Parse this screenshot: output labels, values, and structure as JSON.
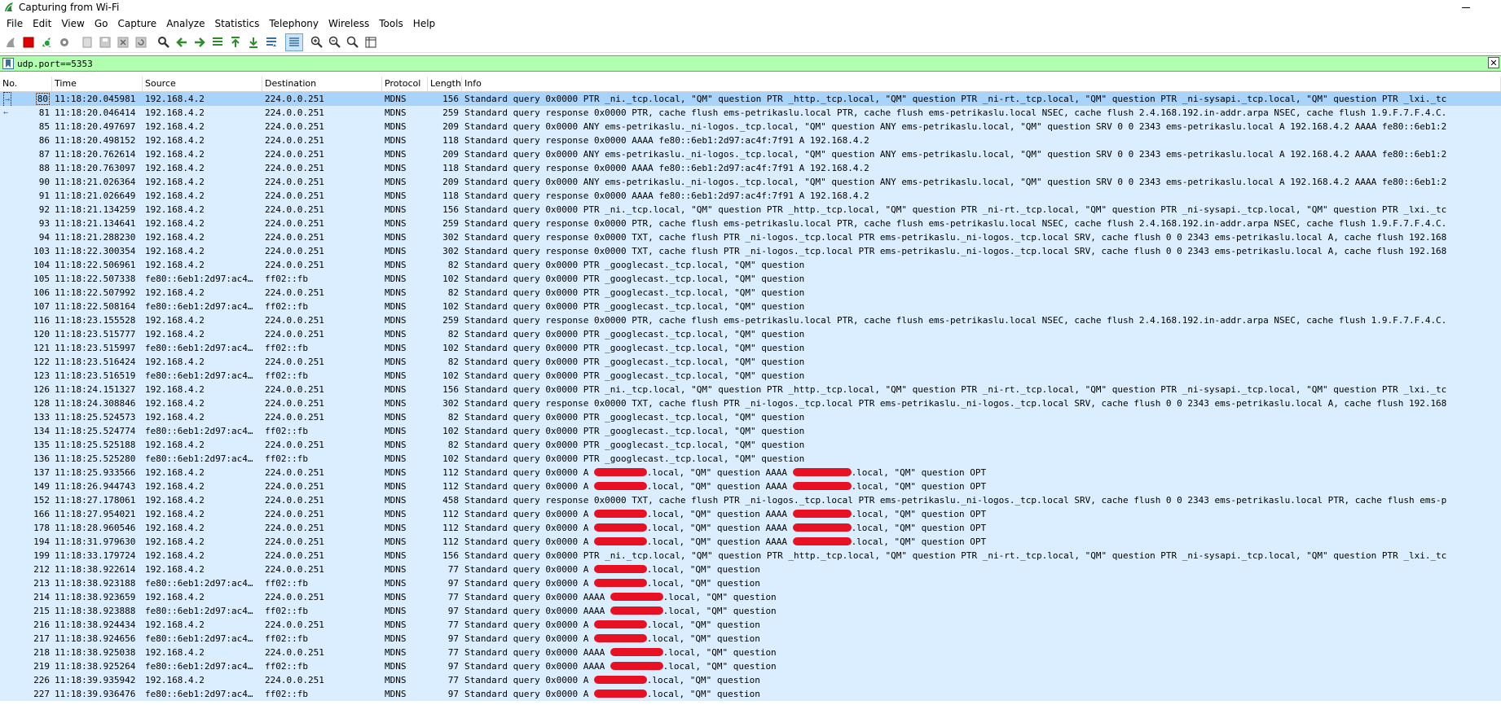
{
  "window": {
    "title": "Capturing from Wi-Fi"
  },
  "menu": [
    "File",
    "Edit",
    "View",
    "Go",
    "Capture",
    "Analyze",
    "Statistics",
    "Telephony",
    "Wireless",
    "Tools",
    "Help"
  ],
  "toolbar": {
    "icons": [
      "shark-fin-icon",
      "stop-icon",
      "restart-icon",
      "options-gear-icon",
      "open-file-icon",
      "save-file-icon",
      "close-file-icon",
      "reload-file-icon",
      "find-icon",
      "back-icon",
      "forward-icon",
      "goto-packet-icon",
      "first-packet-icon",
      "last-packet-icon",
      "autoscroll-icon",
      "colorize-icon",
      "zoom-in-icon",
      "zoom-out-icon",
      "zoom-normal-icon",
      "resize-columns-icon"
    ]
  },
  "filter": {
    "value": "udp.port==5353",
    "bg_color": "#afffaf"
  },
  "columns": [
    "No.",
    "Time",
    "Source",
    "Destination",
    "Protocol",
    "Length",
    "Info"
  ],
  "colors": {
    "row_bg": "#daeeff",
    "selected_bg": "#a8d4fb",
    "redaction": "#e81123"
  },
  "packets": [
    {
      "no": "80",
      "time": "11:18:20.045981",
      "src": "192.168.4.2",
      "dst": "224.0.0.251",
      "proto": "MDNS",
      "len": "156",
      "info": [
        {
          "t": "Standard query 0x0000 PTR _ni._tcp.local, \"QM\" question PTR _http._tcp.local, \"QM\" question PTR _ni-rt._tcp.local, \"QM\" question PTR _ni-sysapi._tcp.local, \"QM\" question PTR _lxi._tc"
        }
      ]
    },
    {
      "no": "81",
      "time": "11:18:20.046414",
      "src": "192.168.4.2",
      "dst": "224.0.0.251",
      "proto": "MDNS",
      "len": "259",
      "info": [
        {
          "t": "Standard query response 0x0000 PTR, cache flush ems-petrikaslu.local PTR, cache flush ems-petrikaslu.local NSEC, cache flush 2.4.168.192.in-addr.arpa NSEC, cache flush 1.9.F.7.F.4.C."
        }
      ]
    },
    {
      "no": "85",
      "time": "11:18:20.497697",
      "src": "192.168.4.2",
      "dst": "224.0.0.251",
      "proto": "MDNS",
      "len": "209",
      "info": [
        {
          "t": "Standard query 0x0000 ANY ems-petrikaslu._ni-logos._tcp.local, \"QM\" question ANY ems-petrikaslu.local, \"QM\" question SRV 0 0 2343 ems-petrikaslu.local A 192.168.4.2 AAAA fe80::6eb1:2"
        }
      ]
    },
    {
      "no": "86",
      "time": "11:18:20.498152",
      "src": "192.168.4.2",
      "dst": "224.0.0.251",
      "proto": "MDNS",
      "len": "118",
      "info": [
        {
          "t": "Standard query response 0x0000 AAAA fe80::6eb1:2d97:ac4f:7f91 A 192.168.4.2"
        }
      ]
    },
    {
      "no": "87",
      "time": "11:18:20.762614",
      "src": "192.168.4.2",
      "dst": "224.0.0.251",
      "proto": "MDNS",
      "len": "209",
      "info": [
        {
          "t": "Standard query 0x0000 ANY ems-petrikaslu._ni-logos._tcp.local, \"QM\" question ANY ems-petrikaslu.local, \"QM\" question SRV 0 0 2343 ems-petrikaslu.local A 192.168.4.2 AAAA fe80::6eb1:2"
        }
      ]
    },
    {
      "no": "88",
      "time": "11:18:20.763097",
      "src": "192.168.4.2",
      "dst": "224.0.0.251",
      "proto": "MDNS",
      "len": "118",
      "info": [
        {
          "t": "Standard query response 0x0000 AAAA fe80::6eb1:2d97:ac4f:7f91 A 192.168.4.2"
        }
      ]
    },
    {
      "no": "90",
      "time": "11:18:21.026364",
      "src": "192.168.4.2",
      "dst": "224.0.0.251",
      "proto": "MDNS",
      "len": "209",
      "info": [
        {
          "t": "Standard query 0x0000 ANY ems-petrikaslu._ni-logos._tcp.local, \"QM\" question ANY ems-petrikaslu.local, \"QM\" question SRV 0 0 2343 ems-petrikaslu.local A 192.168.4.2 AAAA fe80::6eb1:2"
        }
      ]
    },
    {
      "no": "91",
      "time": "11:18:21.026649",
      "src": "192.168.4.2",
      "dst": "224.0.0.251",
      "proto": "MDNS",
      "len": "118",
      "info": [
        {
          "t": "Standard query response 0x0000 AAAA fe80::6eb1:2d97:ac4f:7f91 A 192.168.4.2"
        }
      ]
    },
    {
      "no": "92",
      "time": "11:18:21.134259",
      "src": "192.168.4.2",
      "dst": "224.0.0.251",
      "proto": "MDNS",
      "len": "156",
      "info": [
        {
          "t": "Standard query 0x0000 PTR _ni._tcp.local, \"QM\" question PTR _http._tcp.local, \"QM\" question PTR _ni-rt._tcp.local, \"QM\" question PTR _ni-sysapi._tcp.local, \"QM\" question PTR _lxi._tc"
        }
      ]
    },
    {
      "no": "93",
      "time": "11:18:21.134641",
      "src": "192.168.4.2",
      "dst": "224.0.0.251",
      "proto": "MDNS",
      "len": "259",
      "info": [
        {
          "t": "Standard query response 0x0000 PTR, cache flush ems-petrikaslu.local PTR, cache flush ems-petrikaslu.local NSEC, cache flush 2.4.168.192.in-addr.arpa NSEC, cache flush 1.9.F.7.F.4.C."
        }
      ]
    },
    {
      "no": "94",
      "time": "11:18:21.288230",
      "src": "192.168.4.2",
      "dst": "224.0.0.251",
      "proto": "MDNS",
      "len": "302",
      "info": [
        {
          "t": "Standard query response 0x0000 TXT, cache flush PTR _ni-logos._tcp.local PTR ems-petrikaslu._ni-logos._tcp.local SRV, cache flush 0 0 2343 ems-petrikaslu.local A, cache flush 192.168"
        }
      ]
    },
    {
      "no": "103",
      "time": "11:18:22.300354",
      "src": "192.168.4.2",
      "dst": "224.0.0.251",
      "proto": "MDNS",
      "len": "302",
      "info": [
        {
          "t": "Standard query response 0x0000 TXT, cache flush PTR _ni-logos._tcp.local PTR ems-petrikaslu._ni-logos._tcp.local SRV, cache flush 0 0 2343 ems-petrikaslu.local A, cache flush 192.168"
        }
      ]
    },
    {
      "no": "104",
      "time": "11:18:22.506961",
      "src": "192.168.4.2",
      "dst": "224.0.0.251",
      "proto": "MDNS",
      "len": "82",
      "info": [
        {
          "t": "Standard query 0x0000 PTR _googlecast._tcp.local, \"QM\" question"
        }
      ]
    },
    {
      "no": "105",
      "time": "11:18:22.507338",
      "src": "fe80::6eb1:2d97:ac4…",
      "dst": "ff02::fb",
      "proto": "MDNS",
      "len": "102",
      "info": [
        {
          "t": "Standard query 0x0000 PTR _googlecast._tcp.local, \"QM\" question"
        }
      ]
    },
    {
      "no": "106",
      "time": "11:18:22.507992",
      "src": "192.168.4.2",
      "dst": "224.0.0.251",
      "proto": "MDNS",
      "len": "82",
      "info": [
        {
          "t": "Standard query 0x0000 PTR _googlecast._tcp.local, \"QM\" question"
        }
      ]
    },
    {
      "no": "107",
      "time": "11:18:22.508164",
      "src": "fe80::6eb1:2d97:ac4…",
      "dst": "ff02::fb",
      "proto": "MDNS",
      "len": "102",
      "info": [
        {
          "t": "Standard query 0x0000 PTR _googlecast._tcp.local, \"QM\" question"
        }
      ]
    },
    {
      "no": "116",
      "time": "11:18:23.155528",
      "src": "192.168.4.2",
      "dst": "224.0.0.251",
      "proto": "MDNS",
      "len": "259",
      "info": [
        {
          "t": "Standard query response 0x0000 PTR, cache flush ems-petrikaslu.local PTR, cache flush ems-petrikaslu.local NSEC, cache flush 2.4.168.192.in-addr.arpa NSEC, cache flush 1.9.F.7.F.4.C."
        }
      ]
    },
    {
      "no": "120",
      "time": "11:18:23.515777",
      "src": "192.168.4.2",
      "dst": "224.0.0.251",
      "proto": "MDNS",
      "len": "82",
      "info": [
        {
          "t": "Standard query 0x0000 PTR _googlecast._tcp.local, \"QM\" question"
        }
      ]
    },
    {
      "no": "121",
      "time": "11:18:23.515997",
      "src": "fe80::6eb1:2d97:ac4…",
      "dst": "ff02::fb",
      "proto": "MDNS",
      "len": "102",
      "info": [
        {
          "t": "Standard query 0x0000 PTR _googlecast._tcp.local, \"QM\" question"
        }
      ]
    },
    {
      "no": "122",
      "time": "11:18:23.516424",
      "src": "192.168.4.2",
      "dst": "224.0.0.251",
      "proto": "MDNS",
      "len": "82",
      "info": [
        {
          "t": "Standard query 0x0000 PTR _googlecast._tcp.local, \"QM\" question"
        }
      ]
    },
    {
      "no": "123",
      "time": "11:18:23.516519",
      "src": "fe80::6eb1:2d97:ac4…",
      "dst": "ff02::fb",
      "proto": "MDNS",
      "len": "102",
      "info": [
        {
          "t": "Standard query 0x0000 PTR _googlecast._tcp.local, \"QM\" question"
        }
      ]
    },
    {
      "no": "126",
      "time": "11:18:24.151327",
      "src": "192.168.4.2",
      "dst": "224.0.0.251",
      "proto": "MDNS",
      "len": "156",
      "info": [
        {
          "t": "Standard query 0x0000 PTR _ni._tcp.local, \"QM\" question PTR _http._tcp.local, \"QM\" question PTR _ni-rt._tcp.local, \"QM\" question PTR _ni-sysapi._tcp.local, \"QM\" question PTR _lxi._tc"
        }
      ]
    },
    {
      "no": "128",
      "time": "11:18:24.308846",
      "src": "192.168.4.2",
      "dst": "224.0.0.251",
      "proto": "MDNS",
      "len": "302",
      "info": [
        {
          "t": "Standard query response 0x0000 TXT, cache flush PTR _ni-logos._tcp.local PTR ems-petrikaslu._ni-logos._tcp.local SRV, cache flush 0 0 2343 ems-petrikaslu.local A, cache flush 192.168"
        }
      ]
    },
    {
      "no": "133",
      "time": "11:18:25.524573",
      "src": "192.168.4.2",
      "dst": "224.0.0.251",
      "proto": "MDNS",
      "len": "82",
      "info": [
        {
          "t": "Standard query 0x0000 PTR _googlecast._tcp.local, \"QM\" question"
        }
      ]
    },
    {
      "no": "134",
      "time": "11:18:25.524774",
      "src": "fe80::6eb1:2d97:ac4…",
      "dst": "ff02::fb",
      "proto": "MDNS",
      "len": "102",
      "info": [
        {
          "t": "Standard query 0x0000 PTR _googlecast._tcp.local, \"QM\" question"
        }
      ]
    },
    {
      "no": "135",
      "time": "11:18:25.525188",
      "src": "192.168.4.2",
      "dst": "224.0.0.251",
      "proto": "MDNS",
      "len": "82",
      "info": [
        {
          "t": "Standard query 0x0000 PTR _googlecast._tcp.local, \"QM\" question"
        }
      ]
    },
    {
      "no": "136",
      "time": "11:18:25.525280",
      "src": "fe80::6eb1:2d97:ac4…",
      "dst": "ff02::fb",
      "proto": "MDNS",
      "len": "102",
      "info": [
        {
          "t": "Standard query 0x0000 PTR _googlecast._tcp.local, \"QM\" question"
        }
      ]
    },
    {
      "no": "137",
      "time": "11:18:25.933566",
      "src": "192.168.4.2",
      "dst": "224.0.0.251",
      "proto": "MDNS",
      "len": "112",
      "info": [
        {
          "t": "Standard query 0x0000 A "
        },
        {
          "r": 9
        },
        {
          "t": ".local, \"QM\" question AAAA "
        },
        {
          "r": 10
        },
        {
          "t": ".local, \"QM\" question OPT"
        }
      ]
    },
    {
      "no": "149",
      "time": "11:18:26.944743",
      "src": "192.168.4.2",
      "dst": "224.0.0.251",
      "proto": "MDNS",
      "len": "112",
      "info": [
        {
          "t": "Standard query 0x0000 A "
        },
        {
          "r": 9
        },
        {
          "t": ".local, \"QM\" question AAAA "
        },
        {
          "r": 10
        },
        {
          "t": ".local, \"QM\" question OPT"
        }
      ]
    },
    {
      "no": "152",
      "time": "11:18:27.178061",
      "src": "192.168.4.2",
      "dst": "224.0.0.251",
      "proto": "MDNS",
      "len": "458",
      "info": [
        {
          "t": "Standard query response 0x0000 TXT, cache flush PTR _ni-logos._tcp.local PTR ems-petrikaslu._ni-logos._tcp.local SRV, cache flush 0 0 2343 ems-petrikaslu.local PTR, cache flush ems-p"
        }
      ]
    },
    {
      "no": "166",
      "time": "11:18:27.954021",
      "src": "192.168.4.2",
      "dst": "224.0.0.251",
      "proto": "MDNS",
      "len": "112",
      "info": [
        {
          "t": "Standard query 0x0000 A "
        },
        {
          "r": 9
        },
        {
          "t": ".local, \"QM\" question AAAA "
        },
        {
          "r": 10
        },
        {
          "t": ".local, \"QM\" question OPT"
        }
      ]
    },
    {
      "no": "178",
      "time": "11:18:28.960546",
      "src": "192.168.4.2",
      "dst": "224.0.0.251",
      "proto": "MDNS",
      "len": "112",
      "info": [
        {
          "t": "Standard query 0x0000 A "
        },
        {
          "r": 9
        },
        {
          "t": ".local, \"QM\" question AAAA "
        },
        {
          "r": 10
        },
        {
          "t": ".local, \"QM\" question OPT"
        }
      ]
    },
    {
      "no": "194",
      "time": "11:18:31.979630",
      "src": "192.168.4.2",
      "dst": "224.0.0.251",
      "proto": "MDNS",
      "len": "112",
      "info": [
        {
          "t": "Standard query 0x0000 A "
        },
        {
          "r": 9
        },
        {
          "t": ".local, \"QM\" question AAAA "
        },
        {
          "r": 10
        },
        {
          "t": ".local, \"QM\" question OPT"
        }
      ]
    },
    {
      "no": "199",
      "time": "11:18:33.179724",
      "src": "192.168.4.2",
      "dst": "224.0.0.251",
      "proto": "MDNS",
      "len": "156",
      "info": [
        {
          "t": "Standard query 0x0000 PTR _ni._tcp.local, \"QM\" question PTR _http._tcp.local, \"QM\" question PTR _ni-rt._tcp.local, \"QM\" question PTR _ni-sysapi._tcp.local, \"QM\" question PTR _lxi._tc"
        }
      ]
    },
    {
      "no": "212",
      "time": "11:18:38.922614",
      "src": "192.168.4.2",
      "dst": "224.0.0.251",
      "proto": "MDNS",
      "len": "77",
      "info": [
        {
          "t": "Standard query 0x0000 A "
        },
        {
          "r": 9
        },
        {
          "t": ".local, \"QM\" question"
        }
      ]
    },
    {
      "no": "213",
      "time": "11:18:38.923188",
      "src": "fe80::6eb1:2d97:ac4…",
      "dst": "ff02::fb",
      "proto": "MDNS",
      "len": "97",
      "info": [
        {
          "t": "Standard query 0x0000 A "
        },
        {
          "r": 9
        },
        {
          "t": ".local, \"QM\" question"
        }
      ]
    },
    {
      "no": "214",
      "time": "11:18:38.923659",
      "src": "192.168.4.2",
      "dst": "224.0.0.251",
      "proto": "MDNS",
      "len": "77",
      "info": [
        {
          "t": "Standard query 0x0000 AAAA "
        },
        {
          "r": 9
        },
        {
          "t": ".local, \"QM\" question"
        }
      ]
    },
    {
      "no": "215",
      "time": "11:18:38.923888",
      "src": "fe80::6eb1:2d97:ac4…",
      "dst": "ff02::fb",
      "proto": "MDNS",
      "len": "97",
      "info": [
        {
          "t": "Standard query 0x0000 AAAA "
        },
        {
          "r": 9
        },
        {
          "t": ".local, \"QM\" question"
        }
      ]
    },
    {
      "no": "216",
      "time": "11:18:38.924434",
      "src": "192.168.4.2",
      "dst": "224.0.0.251",
      "proto": "MDNS",
      "len": "77",
      "info": [
        {
          "t": "Standard query 0x0000 A "
        },
        {
          "r": 9
        },
        {
          "t": ".local, \"QM\" question"
        }
      ]
    },
    {
      "no": "217",
      "time": "11:18:38.924656",
      "src": "fe80::6eb1:2d97:ac4…",
      "dst": "ff02::fb",
      "proto": "MDNS",
      "len": "97",
      "info": [
        {
          "t": "Standard query 0x0000 A "
        },
        {
          "r": 9
        },
        {
          "t": ".local, \"QM\" question"
        }
      ]
    },
    {
      "no": "218",
      "time": "11:18:38.925038",
      "src": "192.168.4.2",
      "dst": "224.0.0.251",
      "proto": "MDNS",
      "len": "77",
      "info": [
        {
          "t": "Standard query 0x0000 AAAA "
        },
        {
          "r": 9
        },
        {
          "t": ".local, \"QM\" question"
        }
      ]
    },
    {
      "no": "219",
      "time": "11:18:38.925264",
      "src": "fe80::6eb1:2d97:ac4…",
      "dst": "ff02::fb",
      "proto": "MDNS",
      "len": "97",
      "info": [
        {
          "t": "Standard query 0x0000 AAAA "
        },
        {
          "r": 9
        },
        {
          "t": ".local, \"QM\" question"
        }
      ]
    },
    {
      "no": "226",
      "time": "11:18:39.935942",
      "src": "192.168.4.2",
      "dst": "224.0.0.251",
      "proto": "MDNS",
      "len": "77",
      "info": [
        {
          "t": "Standard query 0x0000 A "
        },
        {
          "r": 9
        },
        {
          "t": ".local, \"QM\" question"
        }
      ]
    },
    {
      "no": "227",
      "time": "11:18:39.936476",
      "src": "fe80::6eb1:2d97:ac4…",
      "dst": "ff02::fb",
      "proto": "MDNS",
      "len": "97",
      "info": [
        {
          "t": "Standard query 0x0000 A "
        },
        {
          "r": 9
        },
        {
          "t": ".local, \"QM\" question"
        }
      ]
    }
  ],
  "selected_packet": "80"
}
